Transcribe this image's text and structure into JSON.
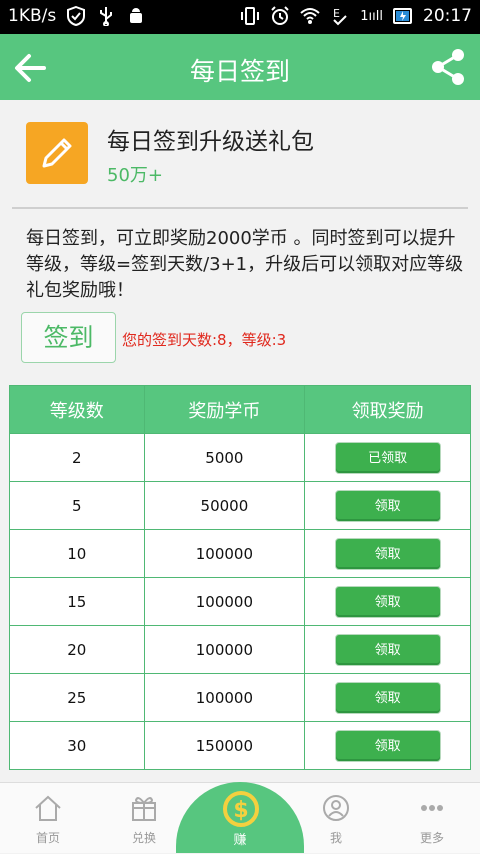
{
  "status_bar": {
    "speed": "1KB/s",
    "signal": "1ııll",
    "time": "20:17"
  },
  "header": {
    "title": "每日签到",
    "back_icon": "arrow-left-icon",
    "share_icon": "share-icon"
  },
  "promo": {
    "title": "每日签到升级送礼包",
    "subtitle": "50万+",
    "description": "每日签到，可立即奖励2000学币 。同时签到可以提升等级，等级=签到天数/3+1，升级后可以领取对应等级礼包奖励哦！",
    "sign_button": "签到",
    "sign_info": "您的签到天数:8，等级:3"
  },
  "table": {
    "headers": [
      "等级数",
      "奖励学币",
      "领取奖励"
    ],
    "rows": [
      {
        "level": "2",
        "coins": "5000",
        "action": "已领取"
      },
      {
        "level": "5",
        "coins": "50000",
        "action": "领取"
      },
      {
        "level": "10",
        "coins": "100000",
        "action": "领取"
      },
      {
        "level": "15",
        "coins": "100000",
        "action": "领取"
      },
      {
        "level": "20",
        "coins": "100000",
        "action": "领取"
      },
      {
        "level": "25",
        "coins": "100000",
        "action": "领取"
      },
      {
        "level": "30",
        "coins": "150000",
        "action": "领取"
      }
    ]
  },
  "bottom_nav": {
    "home": "首页",
    "exchange": "兑换",
    "earn": "赚",
    "me": "我",
    "more": "更多"
  },
  "colors": {
    "accent": "#57c67f",
    "button": "#3db04e",
    "app_icon": "#f6a623",
    "highlight_text": "#e0281d"
  }
}
